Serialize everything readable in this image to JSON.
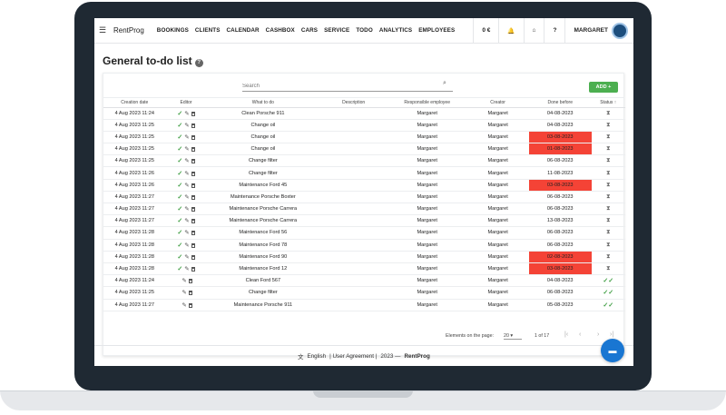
{
  "app": {
    "brand": "RentProg"
  },
  "nav": [
    "BOOKINGS",
    "CLIENTS",
    "CALENDAR",
    "CASHBOX",
    "CARS",
    "SERVICE",
    "TODO",
    "ANALYTICS",
    "EMPLOYEES"
  ],
  "topbar": {
    "balance": "0 €",
    "user": "MARGARET"
  },
  "page": {
    "title": "General to-do list"
  },
  "search": {
    "placeholder": "Search"
  },
  "add_button": "ADD +",
  "table": {
    "headers": [
      "Creation date",
      "Editor",
      "What to do",
      "Description",
      "Responsible employee",
      "Creator",
      "Done before",
      "Status ↑"
    ],
    "rows": [
      {
        "date": "4 Aug 2023 11:24",
        "editor": "full",
        "what": "Clean Porsche 911",
        "desc": "",
        "resp": "Margaret",
        "creator": "Margaret",
        "done": "04-08-2023",
        "red": false,
        "status": "pending"
      },
      {
        "date": "4 Aug 2023 11:25",
        "editor": "full",
        "what": "Change oil",
        "desc": "",
        "resp": "Margaret",
        "creator": "Margaret",
        "done": "04-08-2023",
        "red": false,
        "status": "pending"
      },
      {
        "date": "4 Aug 2023 11:25",
        "editor": "full",
        "what": "Change oil",
        "desc": "",
        "resp": "Margaret",
        "creator": "Margaret",
        "done": "03-08-2023",
        "red": true,
        "status": "pending"
      },
      {
        "date": "4 Aug 2023 11:25",
        "editor": "full",
        "what": "Change oil",
        "desc": "",
        "resp": "Margaret",
        "creator": "Margaret",
        "done": "01-08-2023",
        "red": true,
        "status": "pending"
      },
      {
        "date": "4 Aug 2023 11:25",
        "editor": "full",
        "what": "Change filter",
        "desc": "",
        "resp": "Margaret",
        "creator": "Margaret",
        "done": "06-08-2023",
        "red": false,
        "status": "pending"
      },
      {
        "date": "4 Aug 2023 11:26",
        "editor": "full",
        "what": "Change filter",
        "desc": "",
        "resp": "Margaret",
        "creator": "Margaret",
        "done": "11-08-2023",
        "red": false,
        "status": "pending"
      },
      {
        "date": "4 Aug 2023 11:26",
        "editor": "full",
        "what": "Maintenance Ford 45",
        "desc": "",
        "resp": "Margaret",
        "creator": "Margaret",
        "done": "03-08-2023",
        "red": true,
        "status": "pending"
      },
      {
        "date": "4 Aug 2023 11:27",
        "editor": "full",
        "what": "Maintenance Porsche Boxter",
        "desc": "",
        "resp": "Margaret",
        "creator": "Margaret",
        "done": "06-08-2023",
        "red": false,
        "status": "pending"
      },
      {
        "date": "4 Aug 2023 11:27",
        "editor": "full",
        "what": "Maintenance Porsche Carrera",
        "desc": "",
        "resp": "Margaret",
        "creator": "Margaret",
        "done": "06-08-2023",
        "red": false,
        "status": "pending"
      },
      {
        "date": "4 Aug 2023 11:27",
        "editor": "full",
        "what": "Maintenance Porsche Carrera",
        "desc": "",
        "resp": "Margaret",
        "creator": "Margaret",
        "done": "13-08-2023",
        "red": false,
        "status": "pending"
      },
      {
        "date": "4 Aug 2023 11:28",
        "editor": "full",
        "what": "Maintenance Ford 56",
        "desc": "",
        "resp": "Margaret",
        "creator": "Margaret",
        "done": "06-08-2023",
        "red": false,
        "status": "pending"
      },
      {
        "date": "4 Aug 2023 11:28",
        "editor": "full",
        "what": "Maintenance Ford 78",
        "desc": "",
        "resp": "Margaret",
        "creator": "Margaret",
        "done": "06-08-2023",
        "red": false,
        "status": "pending"
      },
      {
        "date": "4 Aug 2023 11:28",
        "editor": "full",
        "what": "Maintenance Ford 90",
        "desc": "",
        "resp": "Margaret",
        "creator": "Margaret",
        "done": "02-08-2023",
        "red": true,
        "status": "pending"
      },
      {
        "date": "4 Aug 2023 11:28",
        "editor": "full",
        "what": "Maintenance Ford 12",
        "desc": "",
        "resp": "Margaret",
        "creator": "Margaret",
        "done": "03-08-2023",
        "red": true,
        "status": "pending"
      },
      {
        "date": "4 Aug 2023 11:24",
        "editor": "partial",
        "what": "Clean Ford 567",
        "desc": "",
        "resp": "Margaret",
        "creator": "Margaret",
        "done": "04-08-2023",
        "red": false,
        "status": "done"
      },
      {
        "date": "4 Aug 2023 11:25",
        "editor": "partial",
        "what": "Change filter",
        "desc": "",
        "resp": "Margaret",
        "creator": "Margaret",
        "done": "06-08-2023",
        "red": false,
        "status": "done"
      },
      {
        "date": "4 Aug 2023 11:27",
        "editor": "partial",
        "what": "Maintenance Porsche 911",
        "desc": "",
        "resp": "Margaret",
        "creator": "Margaret",
        "done": "05-08-2023",
        "red": false,
        "status": "done"
      }
    ]
  },
  "pagination": {
    "label": "Elements on the page:",
    "per_page": "20",
    "range": "1 of 17"
  },
  "footer": {
    "language": "English",
    "agreement": "| User Agreement |",
    "copyright": "2023 —",
    "brand": "RentProg"
  },
  "colors": {
    "overdue": "#f44336",
    "accent": "#4caf50",
    "chat": "#1976d2"
  }
}
